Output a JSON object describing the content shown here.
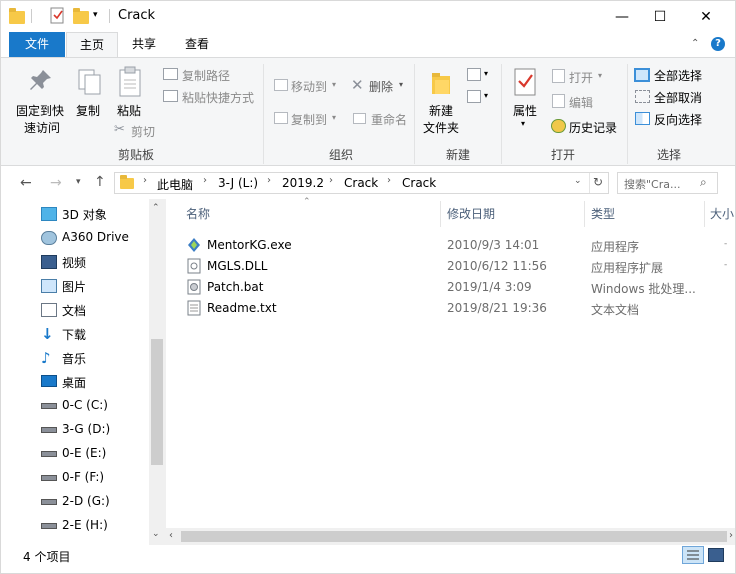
{
  "window": {
    "title": "Crack",
    "controls": {
      "minimize": "—",
      "maximize": "☐",
      "close": "✕"
    }
  },
  "tabs": [
    {
      "label": "文件",
      "active": false
    },
    {
      "label": "主页",
      "active": true
    },
    {
      "label": "共享",
      "active": false
    },
    {
      "label": "查看",
      "active": false
    }
  ],
  "ribbon": {
    "clipboard": {
      "pin_label_1": "固定到快",
      "pin_label_2": "速访问",
      "copy": "复制",
      "paste": "粘贴",
      "copy_path": "复制路径",
      "paste_shortcut": "粘贴快捷方式",
      "cut": "剪切",
      "group_label": "剪贴板"
    },
    "organize": {
      "move_to": "移动到",
      "copy_to": "复制到",
      "delete": "删除",
      "rename": "重命名",
      "group_label": "组织"
    },
    "new": {
      "new_folder_1": "新建",
      "new_folder_2": "文件夹",
      "group_label": "新建"
    },
    "open": {
      "properties": "属性",
      "open": "打开",
      "edit": "编辑",
      "history": "历史记录",
      "group_label": "打开"
    },
    "select": {
      "select_all": "全部选择",
      "select_none": "全部取消",
      "invert": "反向选择",
      "group_label": "选择"
    }
  },
  "address": {
    "crumbs": [
      "此电脑",
      "3-J (L:)",
      "2019.2",
      "Crack",
      "Crack"
    ],
    "search_placeholder": "搜索\"Cra..."
  },
  "nav": [
    {
      "label": "3D 对象",
      "icon": "3d-objects-icon"
    },
    {
      "label": "A360 Drive",
      "icon": "a360-icon"
    },
    {
      "label": "视频",
      "icon": "video-icon"
    },
    {
      "label": "图片",
      "icon": "pictures-icon"
    },
    {
      "label": "文档",
      "icon": "documents-icon"
    },
    {
      "label": "下载",
      "icon": "download-icon"
    },
    {
      "label": "音乐",
      "icon": "music-icon"
    },
    {
      "label": "桌面",
      "icon": "desktop-icon"
    },
    {
      "label": "0-C (C:)",
      "icon": "drive-icon"
    },
    {
      "label": "3-G (D:)",
      "icon": "drive-icon"
    },
    {
      "label": "0-E (E:)",
      "icon": "drive-icon"
    },
    {
      "label": "0-F (F:)",
      "icon": "drive-icon"
    },
    {
      "label": "2-D (G:)",
      "icon": "drive-icon"
    },
    {
      "label": "2-E (H:)",
      "icon": "drive-icon"
    }
  ],
  "columns": {
    "name": "名称",
    "date": "修改日期",
    "type": "类型",
    "size": "大小"
  },
  "files": [
    {
      "name": "MentorKG.exe",
      "date": "2010/9/3 14:01",
      "type": "应用程序",
      "icon": "exe-icon"
    },
    {
      "name": "MGLS.DLL",
      "date": "2010/6/12 11:56",
      "type": "应用程序扩展",
      "icon": "dll-icon"
    },
    {
      "name": "Patch.bat",
      "date": "2019/1/4 3:09",
      "type": "Windows 批处理...",
      "icon": "bat-icon"
    },
    {
      "name": "Readme.txt",
      "date": "2019/8/21 19:36",
      "type": "文本文档",
      "icon": "txt-icon"
    }
  ],
  "status": {
    "count": "4 个项目"
  },
  "colors": {
    "accent": "#1979ca",
    "ribbon_bg": "#f5f6f7",
    "folder": "#f7c948"
  }
}
